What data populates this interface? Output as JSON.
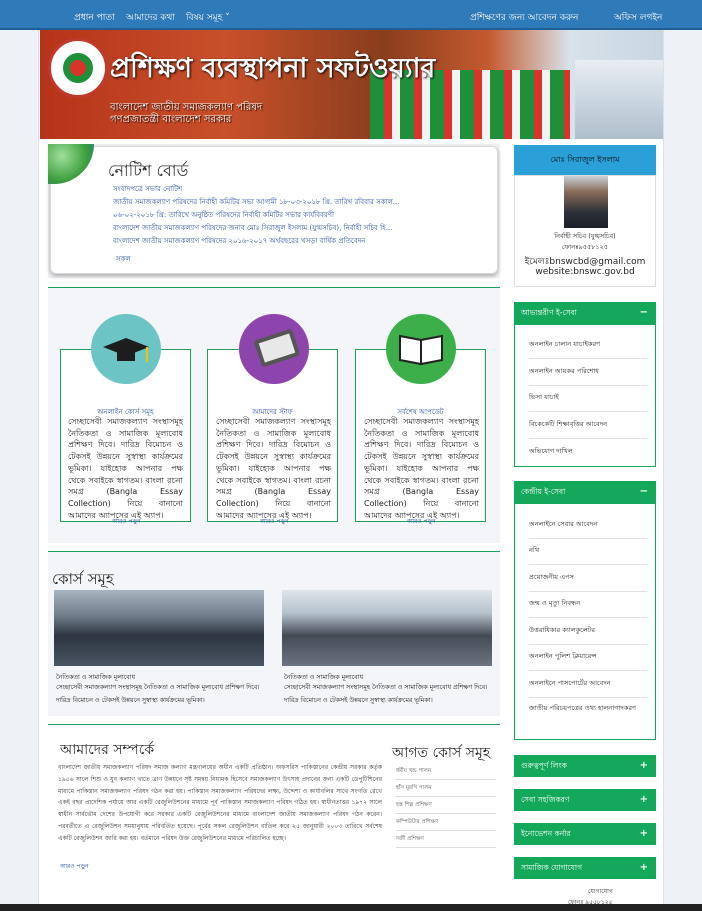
{
  "nav": {
    "home": "প্রধান পাতা",
    "about": "আমাদের কথা",
    "subjects": "বিষয় সমূহ ˅",
    "apply": "প্রশিক্ষণের জন্য আবেদন করুন",
    "login": "অফিস লগইন"
  },
  "banner": {
    "title": "প্রশিক্ষণ ব্যবস্থাপনা সফটওয়্যার",
    "line1": "বাংলাদেশ জাতীয় সমাজকল্যাণ পরিষদ",
    "line2": "গণপ্রজাতন্ত্রী বাংলাদেশ সরকার"
  },
  "notice": {
    "title": "নোটিশ বোর্ড",
    "items": [
      "সংবাদপত্রে সভার নোটিশ",
      "জাতীয় সমাজকল্যাণ পরিষদের নির্বাহী কমিটির সভা আগামী ১৮-০৩-২০১৮ খ্রি. তারিখ রবিবার সকাল...",
      "০৬-০২-২০১৮ খ্রি: তারিখে অনুষ্ঠিত পরিষদের নির্বাহী কমিটির সভার কার্যবিবরণী",
      "বাংলাদেশ জাতীয় সমাজকল্যাণ পরিষদের জনাব মোঃ সিরাজুল ইসলাম (যুগ্মসচিব), নির্বাহী সচিব হি...",
      "বাংলাদেশ জাতীয় সমাজকল্যাণ পরিষদের ২০১৬-২০১৭ অর্থবছরের খসড়া বার্ষিক প্রতিবেদন"
    ],
    "more": "সকল"
  },
  "cards": [
    {
      "title": "অনলাইন কোর্স সমূহ",
      "body": "সেচ্ছাসেবী সমাজকল্যাণ সংস্থাসমূহ নৈতিকতা ও সামাজিক মূল্যবোধ প্রশিক্ষণ দিবে। দারিদ্র বিমোচন ও টেকসই উন্নয়নে সুস্বাস্থ্য কার্যক্রমের ভূমিকা। যাইহোক আপনার পক্ষ থেকে সবাইকে স্বাগতম। বাংলা রচনা সমগ্র (Bangla Essay Collection) নিয়ে বানানো আমাদের অ্যাপসের এই অ্যাপ।",
      "more": "আরও পড়ুন",
      "color": "#6cc4c4",
      "icon": "graduation-cap-icon"
    },
    {
      "title": "আমাদের স্টাফ",
      "body": "সেচ্ছাসেবী সমাজকল্যাণ সংস্থাসমূহ নৈতিকতা ও সামাজিক মূল্যবোধ প্রশিক্ষণ দিবে। দারিদ্র বিমোচন ও টেকসই উন্নয়নে সুস্বাস্থ্য কার্যক্রমের ভূমিকা। যাইহোক আপনার পক্ষ থেকে সবাইকে স্বাগতম। বাংলা রচনা সমগ্র (Bangla Essay Collection) নিয়ে বানানো আমাদের অ্যাপসের এই অ্যাপ।",
      "more": "আরও পড়ুন",
      "color": "#8e44ad",
      "icon": "tablet-icon"
    },
    {
      "title": "সর্বশেষ আপডেট",
      "body": "সেচ্ছাসেবী সমাজকল্যাণ সংস্থাসমূহ নৈতিকতা ও সামাজিক মূল্যবোধ প্রশিক্ষণ দিবে। দারিদ্র বিমোচন ও টেকসই উন্নয়নে সুস্বাস্থ্য কার্যক্রমের ভূমিকা। যাইহোক আপনার পক্ষ থেকে সবাইকে স্বাগতম। বাংলা রচনা সমগ্র (Bangla Essay Collection) নিয়ে বানানো আমাদের অ্যাপসের এই অ্যাপ।",
      "more": "আরও পড়ুন",
      "color": "#3cae4a",
      "icon": "book-icon"
    }
  ],
  "courses": {
    "title": "কোর্স সমূহ",
    "items": [
      {
        "caption": "নৈতিকতা ও সামাজিক মূল্যবোধ",
        "line1": "সেচ্ছাসেবী সমাজকল্যাণ সংস্থাসমূহ নৈতিকতা ও সামাজিক মূল্যবোধ প্রশিক্ষণ দিবে।",
        "line2": "দারিদ্র বিমোচন ও টেকসই উন্নয়নে সুস্বাস্থ্য কার্যক্রমের ভূমিকা।"
      },
      {
        "caption": "নৈতিকতা ও সামাজিক মূল্যবোধ",
        "line1": "সেচ্ছাসেবী সমাজকল্যাণ সংস্থাসমূহ নৈতিকতা ও সামাজিক মূল্যবোধ প্রশিক্ষণ দিবে।",
        "line2": "দারিদ্র বিমোচন ও টেকসই উন্নয়নে সুস্বাস্থ্য কার্যক্রমের ভূমিকা।"
      }
    ]
  },
  "about": {
    "title": "আমাদের সম্পর্কে",
    "text": "বাংলাদেশ জাতীয় সমাজকল্যাণ পরিষদ সমাজ কল্যাণ মন্ত্রণালয়ের অধীন একটি প্রতিষ্ঠান। অফসরিস পাকিস্তানের কেন্দ্রীয় সরকার কর্তৃক ১৯৫৬ সালে শিশু ও যুব কল্যাণ খাতে ত্রাণ উন্নয়নে সৃষ্ট সমন্বয় নিয়ামক হিসেবে সমাজকল্যাণ উৎসাহ প্রদানের জন্য একটি ডেপুটিশিনের মাধ্যমে পাকিস্তান সমাজকল্যাণ পরিষদ গঠন করা হয়। পাকিস্তান সমাজকল্যাণ পরিষদের লক্ষ্য, উদ্দেশ্য ও কার্যাবলির সাথে সংগতি রেখে একই বছর প্রাদেশিক পর্যায়ে আর একটি রেজুলিউশনের মাধ্যমে পূর্ব পাকিস্তান সমাজকল্যাণ পরিষদ গঠিত হয়। স্বাধীনতাত্তর ১৯৭২ সালে স্বাধীন সার্বভৌম দেশের উপযোগী করে সরকার একটি রেজুলিউশনের মাধ্যমে বাংলাদেশ জাতীয় সমাজকল্যাণ পরিষদ গঠন করেন। পরবর্তীতে এ রেজুলিউশন সময়ানুযায় পরিবর্তিত হয়েছে। পূর্বের সকল রেজুলিউশন বাতিল করে ২৫ জানুয়ারী ২০০৩ তারিখে সর্বশেষ একটি রেজুলিউশন জারি করা হয়। বর্তমানে পরিষদ উক্ত রেজুলিউশনের মাধ্যমে পরিচালিত হচ্ছে।",
    "more": "আরও পড়ুন"
  },
  "upcoming": {
    "title": "আগত কোর্স সমূহ",
    "items": [
      "ধর্মীয় খন্ড পালন",
      "হাঁস মুরগি পালন",
      "হস্ত শিল্প প্রশিক্ষণ",
      "কম্পিউটার প্রশিক্ষণ",
      "দর্জী প্রশিক্ষণ"
    ]
  },
  "profile": {
    "name": "মোঃ সিরাজুল ইসলাম",
    "designation": "নির্বাহী সচিব (যুগ্মসচিব)",
    "phone": "ফোনঃ৯৫৫৮১২৫",
    "email": "ইমেলঃbnswcbd@gmail.com",
    "website": "website:bnswc.gov.bd"
  },
  "services": {
    "title": "আভ্যন্তরীণ ই-সেবা",
    "items": [
      "অনলাইন চালান যাচাইকরণ",
      "অনলাইন আয়কর পরিশোধ",
      "ভিসা যাচাই",
      "বিকেকেটি শিক্ষাবৃত্তির আবেদন",
      "অভিযোগ দাখিল"
    ]
  },
  "central": {
    "title": "কেন্দ্রীয় ই-সেবা",
    "items": [
      "অনলাইনে সেবার আবেদন",
      "নথি",
      "প্রয়োজনীয় এপস",
      "জন্ম ও মৃত্যু নিবন্ধন",
      "উত্তরাধিকার ক্যালকুলেটর",
      "অনলাইন পুলিশ ক্লিয়ারেন্স",
      "অনলাইনে পাসপোর্টের আবেদন",
      "জাতীয় পরিচয়পত্রের তথ্য হালনাগাদকরণ"
    ]
  },
  "collapsed": [
    "গুরুত্বপূর্ণ লিংক",
    "সেবা সহজিকরণ",
    "ইনোভেশন কর্নার",
    "সামাজিক যোগাযোগ"
  ],
  "footer": {
    "contact": "যোগাযোগ",
    "phone": "ফোনঃ ৯৫৫৮১২৫"
  },
  "colors": {
    "nav": "#2f7ab8",
    "accent": "#14a85a",
    "profile": "#2b9fd8",
    "link": "#2a4fa5"
  }
}
